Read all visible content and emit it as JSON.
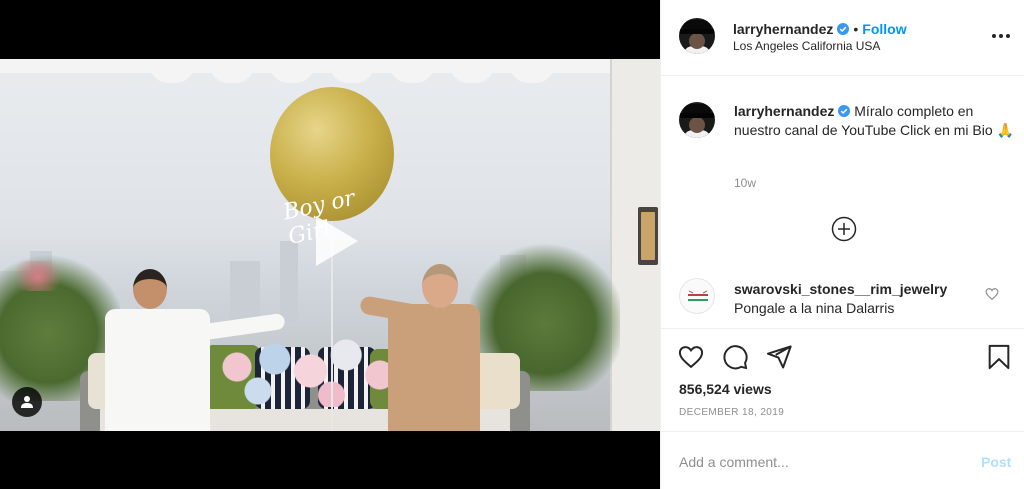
{
  "post": {
    "username": "larryhernandez",
    "location": "Los Angeles California USA",
    "follow_label": "Follow",
    "separator": "•"
  },
  "media": {
    "balloon_text": "Boy or Girl",
    "icons": {
      "play": "play-icon",
      "tagged_users": "user-icon"
    }
  },
  "caption": {
    "username": "larryhernandez",
    "text": "Míralo completo en nuestro canal de YouTube Click en mi Bio 🙏",
    "time_ago": "10w"
  },
  "comments": [
    {
      "username": "swarovski_stones__rim_jewelry",
      "text": "Pongale a la nina Dalarris"
    }
  ],
  "stats": {
    "views": "856,524 views",
    "date": "DECEMBER 18, 2019"
  },
  "comment_box": {
    "placeholder": "Add a comment...",
    "post_label": "Post"
  },
  "colors": {
    "accent": "#0095f6",
    "post_disabled": "#b2dffc",
    "muted": "#8e8e8e",
    "text": "#262626",
    "verified": "#3897f0"
  }
}
